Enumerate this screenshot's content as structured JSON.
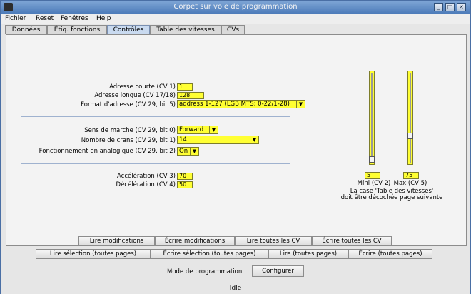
{
  "window": {
    "title": "Corpet sur voie de programmation"
  },
  "menu": {
    "items": [
      "Fichier",
      "Reset",
      "Fenêtres",
      "Help"
    ]
  },
  "tabs": [
    "Données",
    "Étiq. fonctions",
    "Contrôles",
    "Table des vitesses",
    "CVs"
  ],
  "active_tab": "Contrôles",
  "fields": {
    "short_address": {
      "label": "Adresse courte (CV 1)",
      "value": "1"
    },
    "long_address": {
      "label": "Adresse longue (CV 17/18)",
      "value": "128"
    },
    "address_format": {
      "label": "Format d'adresse (CV 29, bit 5)",
      "value": "address 1-127 (LGB MTS: 0-22/1-28)"
    },
    "direction": {
      "label": "Sens de marche (CV 29, bit 0)",
      "value": "Forward"
    },
    "speed_steps": {
      "label": "Nombre de crans (CV 29, bit 1)",
      "value": "14"
    },
    "analog_mode": {
      "label": "Fonctionnement en analogique (CV 29, bit 2)",
      "value": "On"
    },
    "acceleration": {
      "label": "Accélération (CV 3)",
      "value": "70"
    },
    "deceleration": {
      "label": "Décélération (CV 4)",
      "value": "50"
    }
  },
  "sliders": {
    "mini": {
      "label": "Mini (CV 2)",
      "value": "5",
      "fraction": 0.02
    },
    "max": {
      "label": "Max (CV 5)",
      "value": "75",
      "fraction": 0.29
    }
  },
  "note": {
    "line1": "La case 'Table des vitesses'",
    "line2": "doit être décochée page suivante"
  },
  "buttons_row1": [
    "Lire modifications",
    "Écrire modifications",
    "Lire toutes les CV",
    "Écrire toutes les CV"
  ],
  "buttons_row2": [
    "Lire sélection (toutes pages)",
    "Écrire sélection (toutes pages)",
    "Lire (toutes pages)",
    "Écrire (toutes pages)"
  ],
  "programming": {
    "label": "Mode de programmation",
    "button": "Configurer"
  },
  "status": "Idle"
}
